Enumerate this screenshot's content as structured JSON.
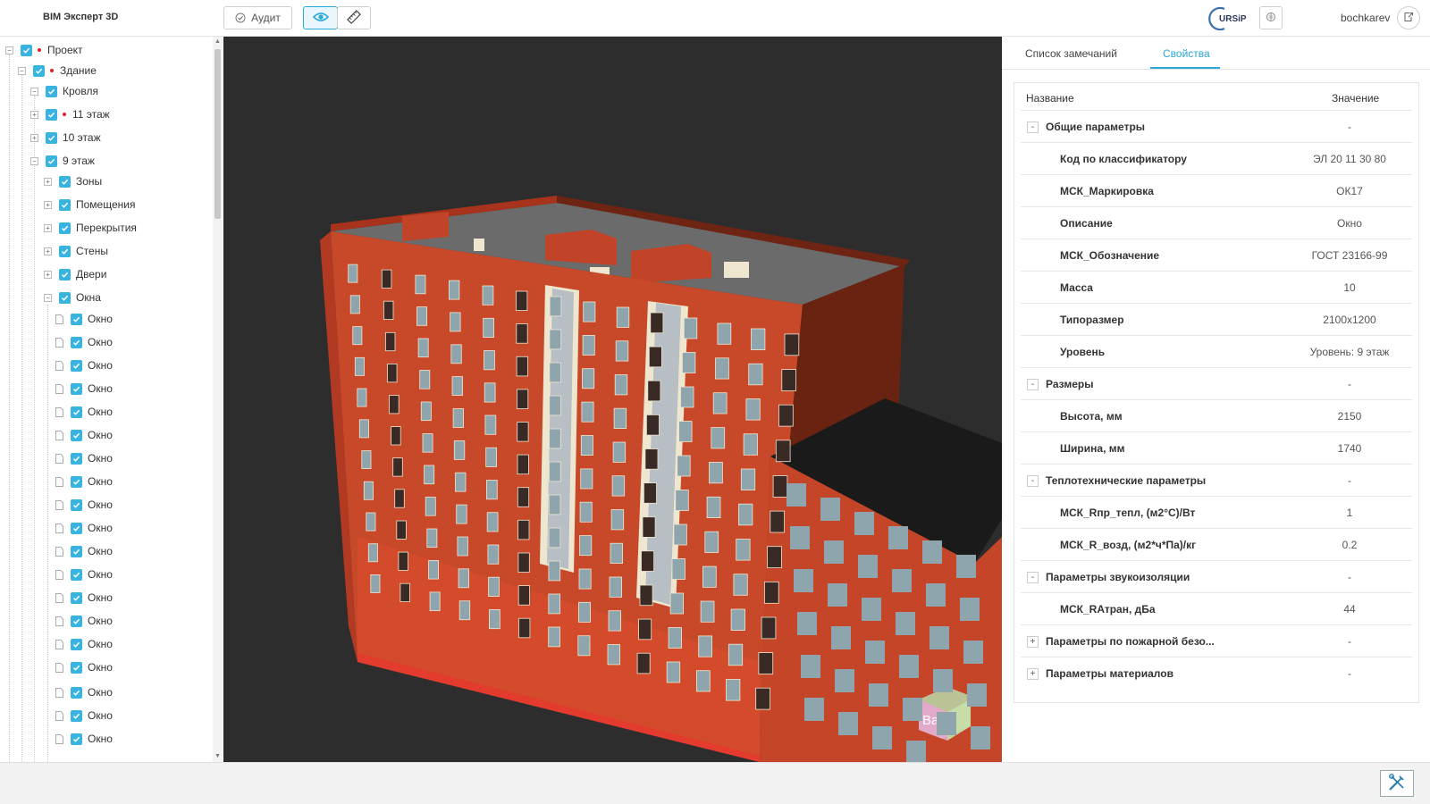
{
  "header": {
    "app_title": "BIM Эксперт 3D",
    "audit_label": "Аудит",
    "logo_text": "URSiP",
    "username": "bochkarev"
  },
  "tree": {
    "items": [
      {
        "label": "Проект",
        "level": 0,
        "expander": "−",
        "marked": true
      },
      {
        "label": "Здание",
        "level": 1,
        "expander": "−",
        "marked": true
      },
      {
        "label": "Кровля",
        "level": 2,
        "expander": "−",
        "marked": false
      },
      {
        "label": "11 этаж",
        "level": 2,
        "expander": "+",
        "marked": true
      },
      {
        "label": "10 этаж",
        "level": 2,
        "expander": "+",
        "marked": false
      },
      {
        "label": "9 этаж",
        "level": 2,
        "expander": "−",
        "marked": false
      },
      {
        "label": "Зоны",
        "level": 3,
        "expander": "+",
        "marked": false
      },
      {
        "label": "Помещения",
        "level": 3,
        "expander": "+",
        "marked": false
      },
      {
        "label": "Перекрытия",
        "level": 3,
        "expander": "+",
        "marked": false
      },
      {
        "label": "Стены",
        "level": 3,
        "expander": "+",
        "marked": false
      },
      {
        "label": "Двери",
        "level": 3,
        "expander": "+",
        "marked": false
      },
      {
        "label": "Окна",
        "level": 3,
        "expander": "−",
        "marked": false
      },
      {
        "label": "Окно",
        "level": 4,
        "expander": "",
        "marked": false
      },
      {
        "label": "Окно",
        "level": 4,
        "expander": "",
        "marked": false
      },
      {
        "label": "Окно",
        "level": 4,
        "expander": "",
        "marked": false
      },
      {
        "label": "Окно",
        "level": 4,
        "expander": "",
        "marked": false
      },
      {
        "label": "Окно",
        "level": 4,
        "expander": "",
        "marked": false
      },
      {
        "label": "Окно",
        "level": 4,
        "expander": "",
        "marked": false
      },
      {
        "label": "Окно",
        "level": 4,
        "expander": "",
        "marked": false
      },
      {
        "label": "Окно",
        "level": 4,
        "expander": "",
        "marked": false
      },
      {
        "label": "Окно",
        "level": 4,
        "expander": "",
        "marked": false
      },
      {
        "label": "Окно",
        "level": 4,
        "expander": "",
        "marked": false
      },
      {
        "label": "Окно",
        "level": 4,
        "expander": "",
        "marked": false
      },
      {
        "label": "Окно",
        "level": 4,
        "expander": "",
        "marked": false
      },
      {
        "label": "Окно",
        "level": 4,
        "expander": "",
        "marked": false
      },
      {
        "label": "Окно",
        "level": 4,
        "expander": "",
        "marked": false
      },
      {
        "label": "Окно",
        "level": 4,
        "expander": "",
        "marked": false
      },
      {
        "label": "Окно",
        "level": 4,
        "expander": "",
        "marked": false
      },
      {
        "label": "Окно",
        "level": 4,
        "expander": "",
        "marked": false
      },
      {
        "label": "Окно",
        "level": 4,
        "expander": "",
        "marked": false
      },
      {
        "label": "Окно",
        "level": 4,
        "expander": "",
        "marked": false
      }
    ]
  },
  "viewer": {
    "cube_label": "Ba"
  },
  "panel": {
    "tabs": {
      "remarks": "Список замечаний",
      "properties": "Свойства"
    },
    "columns": {
      "name": "Название",
      "value": "Значение"
    },
    "rows": [
      {
        "kind": "group",
        "toggle": "-",
        "name": "Общие параметры",
        "value": "-"
      },
      {
        "kind": "child",
        "name": "Код по классификатору",
        "value": "ЭЛ 20 11 30 80"
      },
      {
        "kind": "child",
        "name": "МСК_Маркировка",
        "value": "ОК17"
      },
      {
        "kind": "child",
        "name": "Описание",
        "value": "Окно"
      },
      {
        "kind": "child",
        "name": "МСК_Обозначение",
        "value": "ГОСТ 23166-99"
      },
      {
        "kind": "child",
        "name": "Масса",
        "value": "10"
      },
      {
        "kind": "child",
        "name": "Типоразмер",
        "value": "2100х1200"
      },
      {
        "kind": "child",
        "name": "Уровень",
        "value": "Уровень: 9 этаж"
      },
      {
        "kind": "group",
        "toggle": "-",
        "name": "Размеры",
        "value": "-"
      },
      {
        "kind": "child",
        "name": "Высота, мм",
        "value": "2150"
      },
      {
        "kind": "child",
        "name": "Ширина, мм",
        "value": "1740"
      },
      {
        "kind": "group",
        "toggle": "-",
        "name": "Теплотехнические параметры",
        "value": "-"
      },
      {
        "kind": "child",
        "name": "МСК_Rпр_тепл, (м2°С)/Вт",
        "value": "1"
      },
      {
        "kind": "child",
        "name": "МСК_R_возд, (м2*ч*Па)/кг",
        "value": "0.2"
      },
      {
        "kind": "group",
        "toggle": "-",
        "name": "Параметры звукоизоляции",
        "value": "-"
      },
      {
        "kind": "child",
        "name": "МСК_RАтран, дБа",
        "value": "44"
      },
      {
        "kind": "group",
        "toggle": "+",
        "name": "Параметры по пожарной безо...",
        "value": "-"
      },
      {
        "kind": "group",
        "toggle": "+",
        "name": "Параметры материалов",
        "value": "-"
      }
    ]
  },
  "colors": {
    "accent": "#2aa8d8",
    "checkbox": "#39b3e0",
    "viewer_bg": "#2d2d2d",
    "facade": "#c8482a"
  }
}
